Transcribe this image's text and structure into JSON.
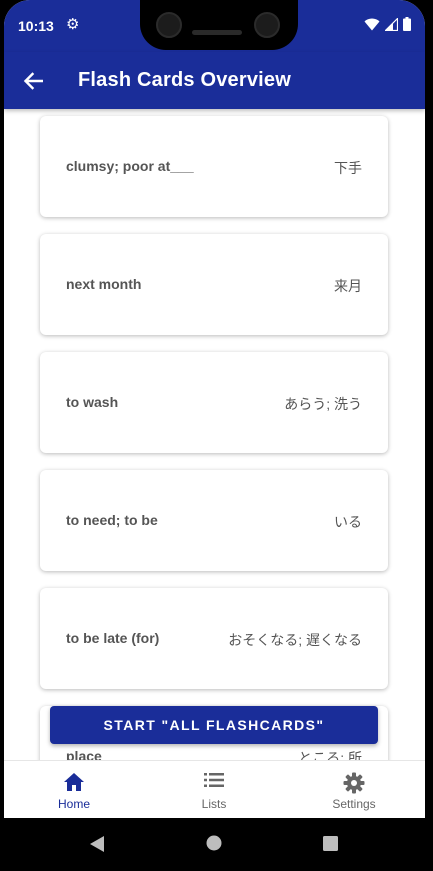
{
  "status_bar": {
    "time": "10:13"
  },
  "app_bar": {
    "title": "Flash Cards Overview"
  },
  "cards": [
    {
      "english": "clumsy; poor at___",
      "japanese": "下手"
    },
    {
      "english": "next month",
      "japanese": "来月"
    },
    {
      "english": "to wash",
      "japanese": "あらう; 洗う"
    },
    {
      "english": "to need; to be",
      "japanese": "いる"
    },
    {
      "english": "to be late (for)",
      "japanese": "おそくなる; 遅くなる"
    },
    {
      "english": "place",
      "japanese": "ところ; 所"
    }
  ],
  "start_button": {
    "label": "START \"ALL FLASHCARDS\""
  },
  "bottom_nav": {
    "items": [
      {
        "label": "Home",
        "icon": "home-icon",
        "active": true
      },
      {
        "label": "Lists",
        "icon": "list-icon",
        "active": false
      },
      {
        "label": "Settings",
        "icon": "gear-icon",
        "active": false
      }
    ]
  },
  "colors": {
    "primary": "#1a2d99",
    "card_text": "#555555",
    "nav_inactive": "#666666"
  }
}
